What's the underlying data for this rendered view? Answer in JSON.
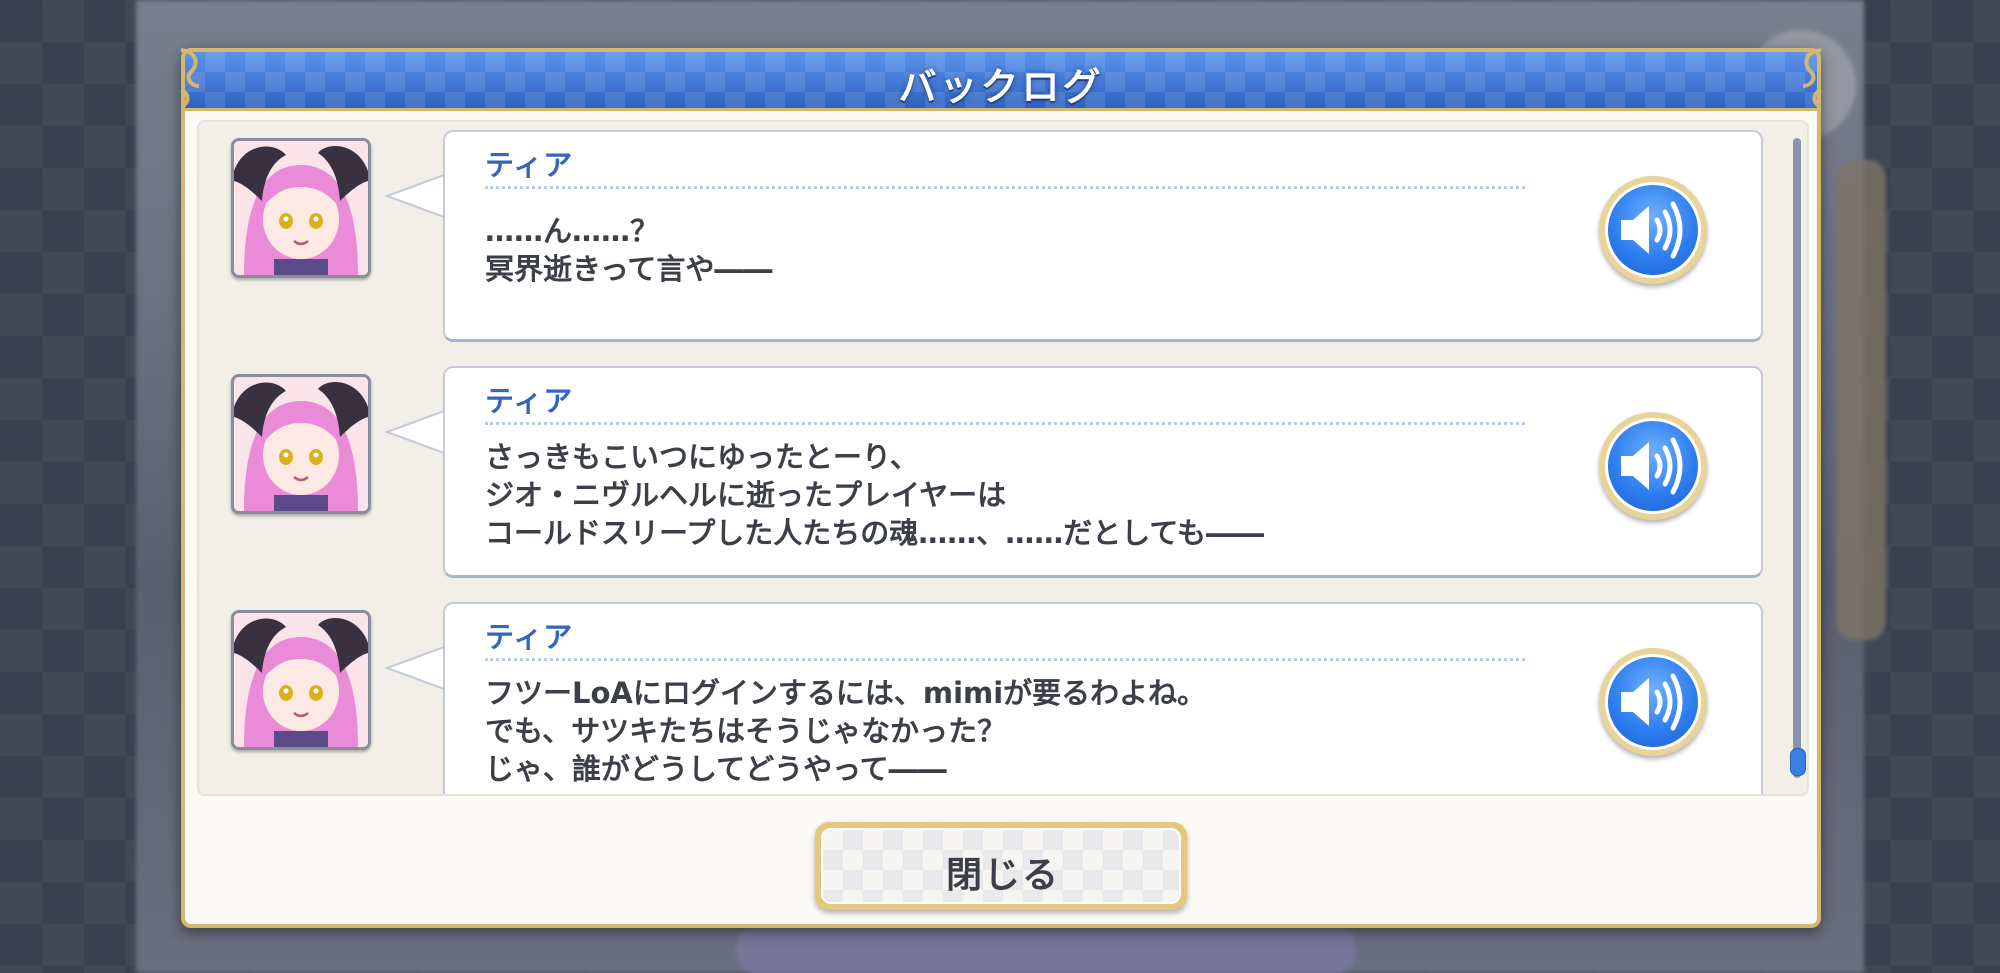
{
  "dialog": {
    "title": "バックログ",
    "close_label": "閉じる"
  },
  "entries": [
    {
      "speaker": "ティア",
      "lines": [
        "……ん……？",
        "冥界逝きって言や――"
      ],
      "avatar_icon": "character-portrait-icon",
      "voice_icon": "speaker-icon"
    },
    {
      "speaker": "ティア",
      "lines": [
        "さっきもこいつにゆったとーり、",
        "ジオ・ニヴルヘルに逝ったプレイヤーは",
        "コールドスリープした人たちの魂……、……だとしても――"
      ],
      "avatar_icon": "character-portrait-icon",
      "voice_icon": "speaker-icon"
    },
    {
      "speaker": "ティア",
      "lines": [
        "フツーLoAにログインするには、mimiが要るわよね。",
        "でも、サツキたちはそうじゃなかった？",
        "じゃ、誰がどうしてどうやって――"
      ],
      "avatar_icon": "character-portrait-icon",
      "voice_icon": "speaker-icon"
    }
  ],
  "colors": {
    "header_blue": "#3f78d6",
    "accent_gold": "#d6b76e",
    "speaker_name": "#3466c0",
    "voice_button": "#2f7ff0"
  }
}
